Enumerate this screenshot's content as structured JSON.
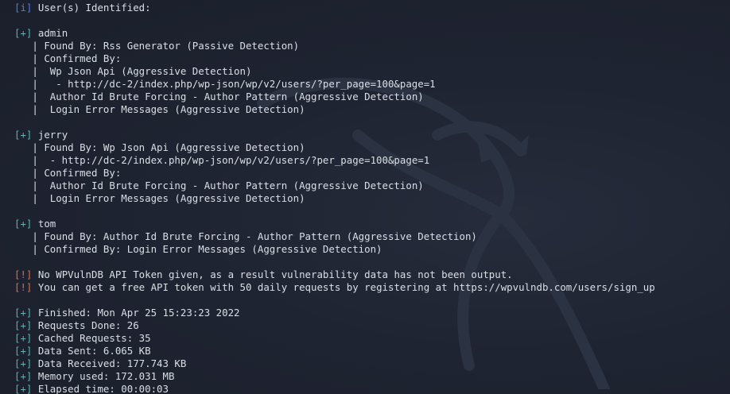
{
  "terminal": {
    "lines": [
      {
        "tag": "[i]",
        "tag_type": "info",
        "indent": "",
        "text": "User(s) Identified:"
      },
      {
        "tag": "",
        "tag_type": "",
        "indent": "",
        "text": ""
      },
      {
        "tag": "[+]",
        "tag_type": "plus",
        "indent": "",
        "text": "admin"
      },
      {
        "tag": "",
        "tag_type": "",
        "indent": "   | ",
        "text": "Found By: Rss Generator (Passive Detection)"
      },
      {
        "tag": "",
        "tag_type": "",
        "indent": "   | ",
        "text": "Confirmed By:"
      },
      {
        "tag": "",
        "tag_type": "",
        "indent": "   |  ",
        "text": "Wp Json Api (Aggressive Detection)"
      },
      {
        "tag": "",
        "tag_type": "",
        "indent": "   |   ",
        "text": "- http://dc-2/index.php/wp-json/wp/v2/users/?per_page=100&page=1"
      },
      {
        "tag": "",
        "tag_type": "",
        "indent": "   |  ",
        "text": "Author Id Brute Forcing - Author Pattern (Aggressive Detection)"
      },
      {
        "tag": "",
        "tag_type": "",
        "indent": "   |  ",
        "text": "Login Error Messages (Aggressive Detection)"
      },
      {
        "tag": "",
        "tag_type": "",
        "indent": "",
        "text": ""
      },
      {
        "tag": "[+]",
        "tag_type": "plus",
        "indent": "",
        "text": "jerry"
      },
      {
        "tag": "",
        "tag_type": "",
        "indent": "   | ",
        "text": "Found By: Wp Json Api (Aggressive Detection)"
      },
      {
        "tag": "",
        "tag_type": "",
        "indent": "   |  ",
        "text": "- http://dc-2/index.php/wp-json/wp/v2/users/?per_page=100&page=1"
      },
      {
        "tag": "",
        "tag_type": "",
        "indent": "   | ",
        "text": "Confirmed By:"
      },
      {
        "tag": "",
        "tag_type": "",
        "indent": "   |  ",
        "text": "Author Id Brute Forcing - Author Pattern (Aggressive Detection)"
      },
      {
        "tag": "",
        "tag_type": "",
        "indent": "   |  ",
        "text": "Login Error Messages (Aggressive Detection)"
      },
      {
        "tag": "",
        "tag_type": "",
        "indent": "",
        "text": ""
      },
      {
        "tag": "[+]",
        "tag_type": "plus",
        "indent": "",
        "text": "tom"
      },
      {
        "tag": "",
        "tag_type": "",
        "indent": "   | ",
        "text": "Found By: Author Id Brute Forcing - Author Pattern (Aggressive Detection)"
      },
      {
        "tag": "",
        "tag_type": "",
        "indent": "   | ",
        "text": "Confirmed By: Login Error Messages (Aggressive Detection)"
      },
      {
        "tag": "",
        "tag_type": "",
        "indent": "",
        "text": ""
      },
      {
        "tag": "[!]",
        "tag_type": "warn",
        "indent": "",
        "text": "No WPVulnDB API Token given, as a result vulnerability data has not been output."
      },
      {
        "tag": "[!]",
        "tag_type": "warn",
        "indent": "",
        "text": "You can get a free API token with 50 daily requests by registering at https://wpvulndb.com/users/sign_up"
      },
      {
        "tag": "",
        "tag_type": "",
        "indent": "",
        "text": ""
      },
      {
        "tag": "[+]",
        "tag_type": "plus",
        "indent": "",
        "text": "Finished: Mon Apr 25 15:23:23 2022"
      },
      {
        "tag": "[+]",
        "tag_type": "plus",
        "indent": "",
        "text": "Requests Done: 26"
      },
      {
        "tag": "[+]",
        "tag_type": "plus",
        "indent": "",
        "text": "Cached Requests: 35"
      },
      {
        "tag": "[+]",
        "tag_type": "plus",
        "indent": "",
        "text": "Data Sent: 6.065 KB"
      },
      {
        "tag": "[+]",
        "tag_type": "plus",
        "indent": "",
        "text": "Data Received: 177.743 KB"
      },
      {
        "tag": "[+]",
        "tag_type": "plus",
        "indent": "",
        "text": "Memory used: 172.031 MB"
      },
      {
        "tag": "[+]",
        "tag_type": "plus",
        "indent": "",
        "text": "Elapsed time: 00:00:03"
      }
    ]
  },
  "colors": {
    "background": "#1d2230",
    "text": "#dcdfe4",
    "info_tag": "#4a7fe0",
    "plus_tag": "#57b2b7",
    "warn_tag": "#e6654f",
    "watermark": "#2c3343"
  },
  "icons": {
    "watermark": "kali-dragon-icon"
  }
}
